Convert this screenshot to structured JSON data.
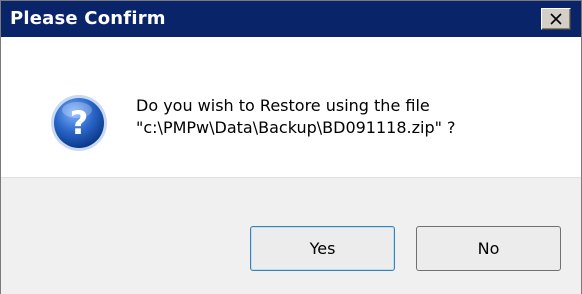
{
  "dialog": {
    "title": "Please Confirm",
    "close_icon": "close-icon",
    "icon": "question-icon",
    "icon_glyph": "?",
    "message_line1": "Do you wish to Restore using the file",
    "message_line2": "\"c:\\PMPw\\Data\\Backup\\BD091118.zip\" ?",
    "buttons": {
      "yes_label": "Yes",
      "no_label": "No"
    },
    "colors": {
      "titlebar": "#0a246a",
      "icon_blue": "#1a56b8"
    }
  }
}
